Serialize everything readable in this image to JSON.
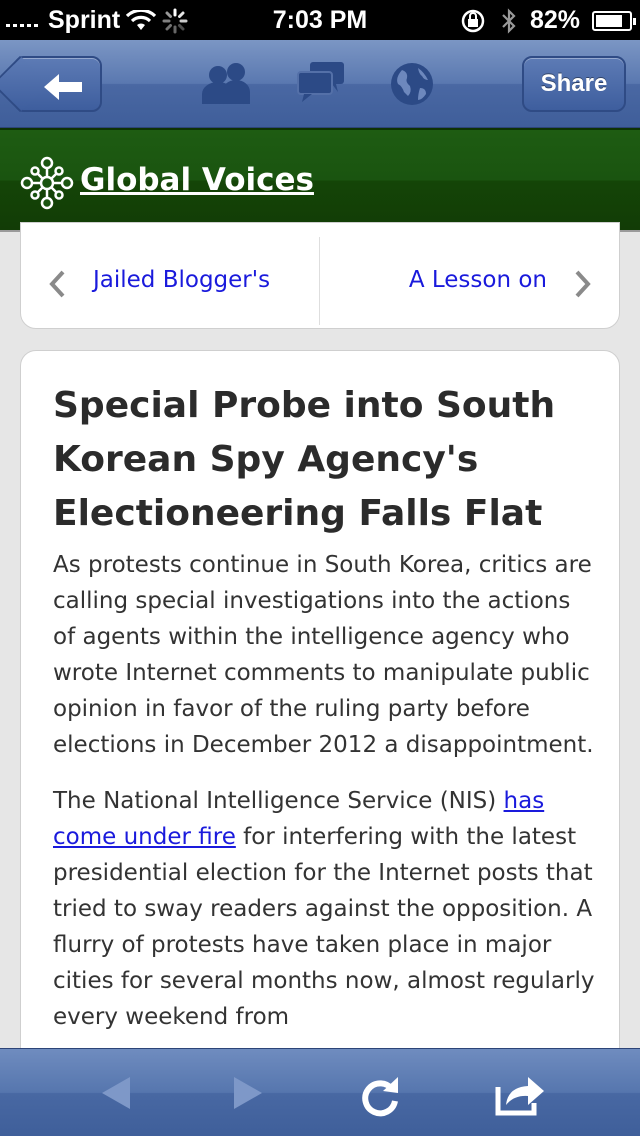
{
  "status_bar": {
    "carrier": "Sprint",
    "time": "7:03 PM",
    "battery_percent": "82%",
    "battery_level": 0.82
  },
  "nav_bar": {
    "back_icon": "back-arrow-icon",
    "icons": [
      "people-icon",
      "comments-icon",
      "globe-icon"
    ],
    "share_label": "Share"
  },
  "site": {
    "title": "Global Voices",
    "logo_icon": "global-voices-logo-icon",
    "header_color": "#1a5410"
  },
  "article_nav": {
    "prev_label": "Jailed Blogger's",
    "next_label": "A Lesson on"
  },
  "article": {
    "title": "Special Probe into South Korean Spy Agency's Electioneering Falls Flat",
    "paragraph1": "As protests continue in South Korea, critics are calling special investigations into the actions of agents within the intelligence agency who wrote Internet comments to manipulate public opinion in favor of the ruling party before elections in December 2012 a disappointment.",
    "paragraph2_before": "The National Intelligence Service (NIS) ",
    "paragraph2_link": "has come under fire",
    "paragraph2_after": " for interfering with the latest presidential election for the Internet posts that tried to sway readers against the opposition. A flurry of protests have taken place in major cities for several months now, almost regularly every weekend from"
  },
  "toolbar": {
    "icons": [
      "back-icon",
      "forward-icon",
      "reload-icon",
      "share-icon"
    ]
  },
  "colors": {
    "nav_blue": "#4a68a3",
    "link_blue": "#1a1adc",
    "header_green": "#1a5410"
  }
}
